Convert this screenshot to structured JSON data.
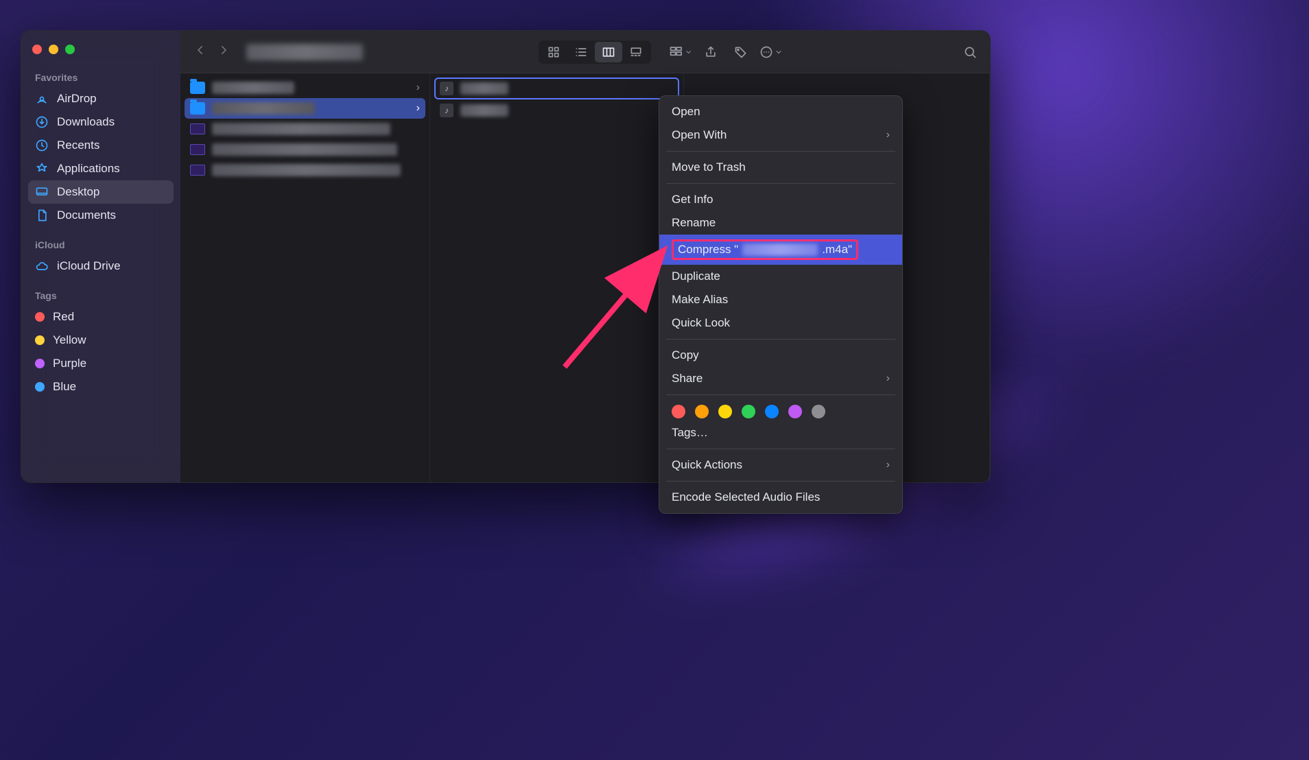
{
  "sidebar": {
    "sections": [
      {
        "title": "Favorites",
        "items": [
          {
            "label": "AirDrop",
            "icon": "airdrop"
          },
          {
            "label": "Downloads",
            "icon": "download"
          },
          {
            "label": "Recents",
            "icon": "clock"
          },
          {
            "label": "Applications",
            "icon": "apps"
          },
          {
            "label": "Desktop",
            "icon": "desktop",
            "active": true
          },
          {
            "label": "Documents",
            "icon": "document"
          }
        ]
      },
      {
        "title": "iCloud",
        "items": [
          {
            "label": "iCloud Drive",
            "icon": "cloud"
          }
        ]
      },
      {
        "title": "Tags",
        "items": [
          {
            "label": "Red",
            "color": "#ff5b5b"
          },
          {
            "label": "Yellow",
            "color": "#ffd33d"
          },
          {
            "label": "Purple",
            "color": "#c063ff"
          },
          {
            "label": "Blue",
            "color": "#3ea6ff"
          }
        ]
      }
    ]
  },
  "toolbar": {
    "title_hidden": true,
    "view_mode": "columns"
  },
  "columns": {
    "col1": [
      {
        "type": "folder",
        "selected": false
      },
      {
        "type": "folder",
        "selected": true
      },
      {
        "type": "image"
      },
      {
        "type": "image"
      },
      {
        "type": "image"
      }
    ],
    "col2": [
      {
        "type": "audio",
        "selected_outline": true
      },
      {
        "type": "audio"
      }
    ]
  },
  "context_menu": {
    "items": [
      {
        "label": "Open"
      },
      {
        "label": "Open With",
        "submenu": true
      },
      {
        "sep": true
      },
      {
        "label": "Move to Trash"
      },
      {
        "sep": true
      },
      {
        "label": "Get Info"
      },
      {
        "label": "Rename"
      },
      {
        "label_prefix": "Compress \"",
        "label_suffix": ".m4a\"",
        "highlight": true,
        "filename_hidden": true
      },
      {
        "label": "Duplicate"
      },
      {
        "label": "Make Alias"
      },
      {
        "label": "Quick Look"
      },
      {
        "sep": true
      },
      {
        "label": "Copy"
      },
      {
        "label": "Share",
        "submenu": true
      },
      {
        "sep": true
      },
      {
        "tag_dots": [
          "#ff5b5b",
          "#ff9f0a",
          "#ffd60a",
          "#30d158",
          "#0a84ff",
          "#bf5af2",
          "#8e8e93"
        ]
      },
      {
        "label": "Tags…"
      },
      {
        "sep": true
      },
      {
        "label": "Quick Actions",
        "submenu": true
      },
      {
        "sep": true
      },
      {
        "label": "Encode Selected Audio Files"
      }
    ]
  },
  "annotation": {
    "arrow_color": "#ff2d6b"
  }
}
